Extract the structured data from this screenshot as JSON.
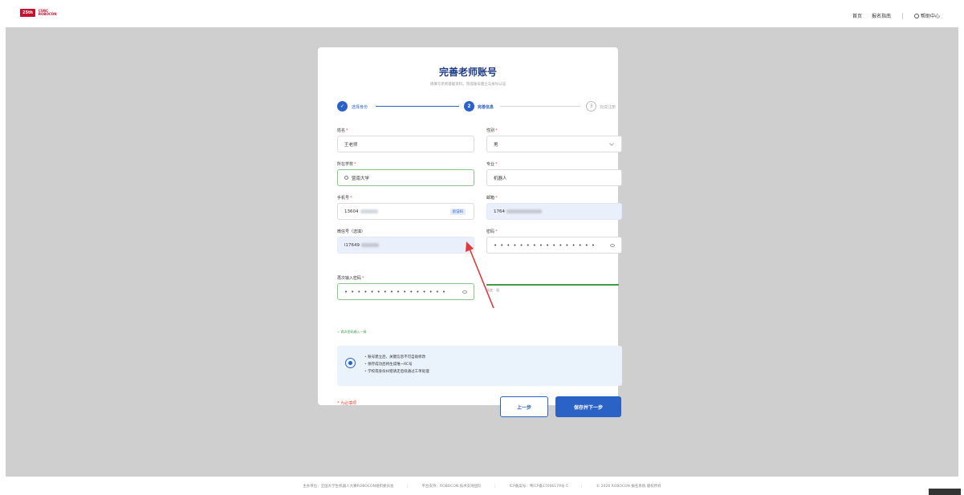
{
  "header": {
    "logo_badge": "25th",
    "logo_line1": "CURC",
    "logo_line2": "ROBOCON",
    "nav": [
      "首页",
      "报名指南"
    ],
    "help": "帮助中心"
  },
  "form": {
    "title": "完善老师账号",
    "subtitle": "请填写老师基础资料，完成账号建立与身份认证",
    "steps": [
      {
        "index": "✓",
        "label": "选择身份"
      },
      {
        "index": "2",
        "label": "完善信息"
      },
      {
        "index": "3",
        "label": "完成注册"
      }
    ],
    "fields": {
      "name": {
        "label": "姓名",
        "value": "王老师"
      },
      "gender": {
        "label": "性别",
        "value": "男"
      },
      "school": {
        "label": "所在学校",
        "value": "暨南大学"
      },
      "major": {
        "label": "专业",
        "value": "机器人"
      },
      "phone": {
        "label": "手机号",
        "value": "13604",
        "code_button": "验证码"
      },
      "email": {
        "label": "邮箱",
        "value": "1764"
      },
      "wechat": {
        "label": "微信号（选填）",
        "value": "i17649"
      },
      "password": {
        "label": "密码",
        "value": "••••••••••••••••",
        "strength": "强度：强"
      },
      "confirm_password": {
        "label": "再次输入密码",
        "value": "••••••••••••••••",
        "match_hint": "✓ 两次密码输入一致"
      }
    },
    "required_mark": "*",
    "notice": [
      "账号建立后，关键信息不可自助修改",
      "保存成功后将生成唯一RC号",
      "学校或身份纠错请走后续通过工单处理"
    ],
    "required_note": "* 为必填项",
    "prev_button": "上一步",
    "next_button": "保存并下一步"
  },
  "footer": {
    "items": [
      "主办单位：全国大学生机器人大赛ROBOCON组织委员会",
      "平台支持：ROBOCON 技术支持团队",
      "ICP备案号：粤ICP备17006179号-5",
      "© 2026 ROBOCON 报名系统 版权所有"
    ]
  },
  "colors": {
    "primary": "#2b62c6",
    "title": "#1f3c88",
    "required": "#e74c3c",
    "success": "#3d9b4a",
    "backdrop": "#cfcfcf",
    "annotation_arrow": "#e03a3a"
  }
}
